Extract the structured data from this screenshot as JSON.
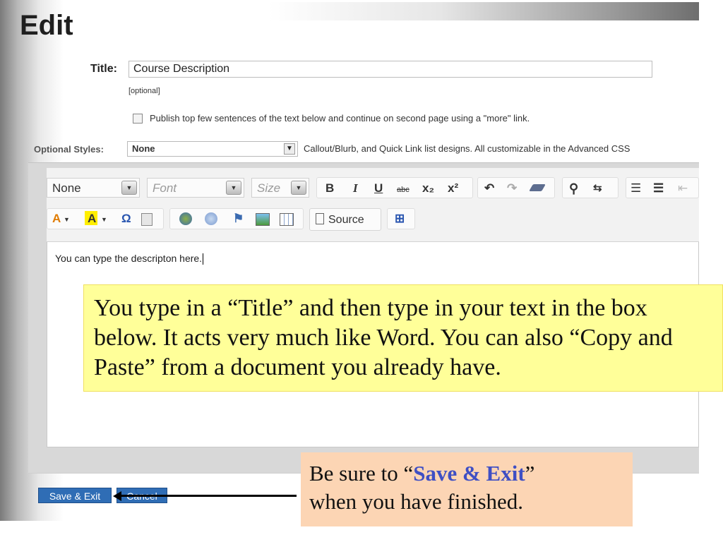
{
  "page": {
    "title": "Edit"
  },
  "form": {
    "title_label": "Title",
    "title_colon": ":",
    "title_value": "Course Description",
    "optional_note": "[optional]",
    "publish_label": "Publish top few sentences of the text below and continue on second page using a \"more\" link.",
    "styles_label": "Optional Styles:",
    "styles_value": "None",
    "styles_help": "Callout/Blurb, and Quick Link list designs. All customizable in the Advanced CSS"
  },
  "toolbar": {
    "format_value": "None",
    "font_placeholder": "Font",
    "size_placeholder": "Size",
    "bold": "B",
    "italic": "I",
    "underline": "U",
    "strike": "abc",
    "subscript": "x₂",
    "superscript": "x²",
    "source_label": "Source"
  },
  "editor": {
    "content": "You can type the descripton here."
  },
  "callouts": {
    "main": "You type in a “Title”  and then type in your text in the box below.  It acts very much like Word.  You can also “Copy and Paste” from a document you already have.",
    "save_prefix": "Be sure to “",
    "save_highlight": "Save & Exit",
    "save_suffix": "”",
    "save_line2": "when you have finished."
  },
  "actions": {
    "save_label": "Save & Exit",
    "cancel_label": "Cancel"
  },
  "colors": {
    "accent_button": "#2f6db5",
    "callout_yellow": "#ffff99",
    "callout_peach": "#fcd5b4",
    "highlight": "#3f4fc4"
  }
}
